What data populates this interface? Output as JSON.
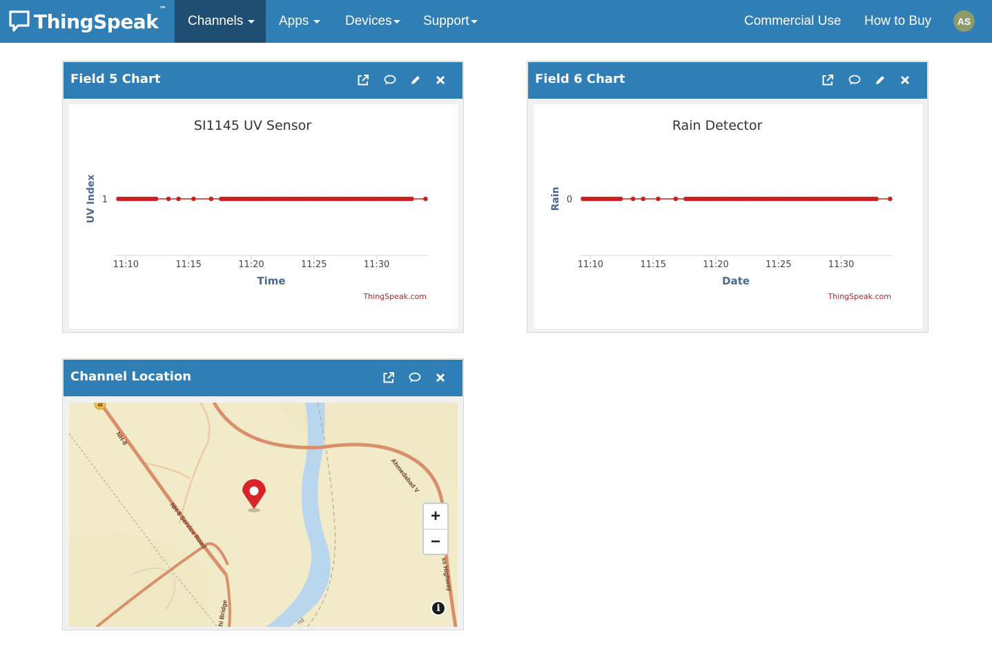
{
  "navbar": {
    "brand": "ThingSpeak",
    "brand_tm": "™",
    "items": [
      {
        "label": "Channels"
      },
      {
        "label": "Apps"
      },
      {
        "label": "Devices"
      },
      {
        "label": "Support"
      }
    ],
    "right_items": [
      {
        "label": "Commercial Use"
      },
      {
        "label": "How to Buy"
      }
    ],
    "avatar_initials": "AS",
    "colors": {
      "bar": "#2f7eb6",
      "active": "#1f4e72",
      "avatar": "#8d9b6a"
    }
  },
  "panels": {
    "field5": {
      "title": "Field 5 Chart",
      "icons": [
        "external-link-icon",
        "comment-icon",
        "pencil-icon",
        "close-icon"
      ]
    },
    "field6": {
      "title": "Field 6 Chart",
      "icons": [
        "external-link-icon",
        "comment-icon",
        "pencil-icon",
        "close-icon"
      ]
    },
    "location": {
      "title": "Channel Location",
      "icons": [
        "external-link-icon",
        "comment-icon",
        "close-icon"
      ]
    }
  },
  "chart_data": [
    {
      "type": "line",
      "title": "SI1145 UV Sensor",
      "xlabel": "Time",
      "ylabel": "UV Index",
      "y_ticks": [
        "1"
      ],
      "x_ticks": [
        "11:10",
        "11:15",
        "11:20",
        "11:25",
        "11:30"
      ],
      "x_tick_minutes": [
        10,
        15,
        20,
        25,
        30
      ],
      "x_start_minute": 9.1,
      "x_end_minute": 34.1,
      "credit": "ThingSpeak.com",
      "series": [
        {
          "color": "#cc1f1f",
          "x_minutes": [
            9.4,
            9.6,
            9.8,
            10.0,
            10.2,
            10.4,
            10.6,
            10.8,
            11.0,
            11.2,
            11.4,
            11.6,
            11.8,
            12.0,
            12.2,
            12.4,
            13.4,
            14.2,
            15.4,
            16.8,
            17.6,
            17.8,
            18.0,
            18.2,
            18.4,
            18.6,
            18.8,
            19.0,
            19.2,
            19.4,
            19.6,
            19.8,
            20.0,
            20.2,
            20.4,
            20.6,
            20.8,
            21.0,
            21.2,
            21.4,
            21.6,
            21.8,
            22.0,
            22.2,
            22.4,
            22.6,
            22.8,
            23.0,
            23.2,
            23.4,
            23.6,
            23.8,
            24.0,
            24.2,
            24.4,
            24.6,
            24.8,
            25.0,
            25.2,
            25.4,
            25.6,
            25.8,
            26.0,
            26.2,
            26.4,
            26.6,
            26.8,
            27.0,
            27.2,
            27.4,
            27.6,
            27.8,
            28.0,
            28.2,
            28.4,
            28.6,
            28.8,
            29.0,
            29.2,
            29.4,
            29.6,
            29.8,
            30.0,
            30.2,
            30.4,
            30.6,
            30.8,
            31.0,
            31.2,
            31.4,
            31.6,
            31.8,
            32.0,
            32.2,
            32.4,
            32.6,
            32.8,
            33.9
          ],
          "value": 1
        }
      ]
    },
    {
      "type": "line",
      "title": "Rain Detector",
      "xlabel": "Date",
      "ylabel": "Rain",
      "y_ticks": [
        "0"
      ],
      "x_ticks": [
        "11:10",
        "11:15",
        "11:20",
        "11:25",
        "11:30"
      ],
      "x_tick_minutes": [
        10,
        15,
        20,
        25,
        30
      ],
      "x_start_minute": 9.1,
      "x_end_minute": 34.1,
      "credit": "ThingSpeak.com",
      "series": [
        {
          "color": "#cc1f1f",
          "x_minutes": [
            9.4,
            9.6,
            9.8,
            10.0,
            10.2,
            10.4,
            10.6,
            10.8,
            11.0,
            11.2,
            11.4,
            11.6,
            11.8,
            12.0,
            12.2,
            12.4,
            13.4,
            14.2,
            15.4,
            16.8,
            17.6,
            17.8,
            18.0,
            18.2,
            18.4,
            18.6,
            18.8,
            19.0,
            19.2,
            19.4,
            19.6,
            19.8,
            20.0,
            20.2,
            20.4,
            20.6,
            20.8,
            21.0,
            21.2,
            21.4,
            21.6,
            21.8,
            22.0,
            22.2,
            22.4,
            22.6,
            22.8,
            23.0,
            23.2,
            23.4,
            23.6,
            23.8,
            24.0,
            24.2,
            24.4,
            24.6,
            24.8,
            25.0,
            25.2,
            25.4,
            25.6,
            25.8,
            26.0,
            26.2,
            26.4,
            26.6,
            26.8,
            27.0,
            27.2,
            27.4,
            27.6,
            27.8,
            28.0,
            28.2,
            28.4,
            28.6,
            28.8,
            29.0,
            29.2,
            29.4,
            29.6,
            29.8,
            30.0,
            30.2,
            30.4,
            30.6,
            30.8,
            31.0,
            31.2,
            31.4,
            31.6,
            31.8,
            32.0,
            32.2,
            32.4,
            32.6,
            32.8,
            33.9
          ],
          "value": 0
        }
      ]
    }
  ],
  "map": {
    "zoom_in": "+",
    "zoom_out": "−",
    "info": "i",
    "road_labels": [
      "NH-8",
      "NH-8 Service Road",
      "Ahmedabad V",
      "ss Highway",
      "nd",
      "hi Bridge",
      "48"
    ],
    "colors": {
      "land": "#f2ebc9",
      "river": "#b8d6ee",
      "road": "#d9906a",
      "marker": "#d9232a"
    }
  }
}
